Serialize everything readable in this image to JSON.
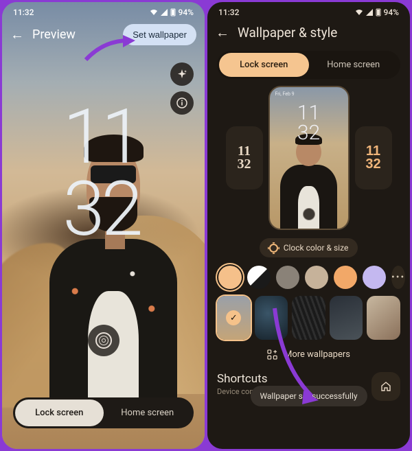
{
  "status": {
    "time": "11:32",
    "battery_pct": "94%"
  },
  "left": {
    "header_title": "Preview",
    "set_wallpaper_label": "Set wallpaper",
    "clock_line1": "11",
    "clock_line2": "32",
    "tab_lock": "Lock screen",
    "tab_home": "Home screen"
  },
  "right": {
    "header_title": "Wallpaper & style",
    "tab_lock": "Lock screen",
    "tab_home": "Home screen",
    "preview_status": "Fri, Feb 9",
    "preview_clock_l1": "11",
    "preview_clock_l2": "32",
    "side_clock_l1": "11",
    "side_clock_l2": "32",
    "clock_color_label": "Clock color & size",
    "swatches": [
      "#f5c08a",
      "split",
      "#8a8278",
      "#c6b29a",
      "#f2a868",
      "#c4b8f0"
    ],
    "more_wallpapers_label": "More wallpapers",
    "toast": "Wallpaper set successfully",
    "shortcuts_title": "Shortcuts",
    "shortcuts_sub": "Device controls"
  }
}
